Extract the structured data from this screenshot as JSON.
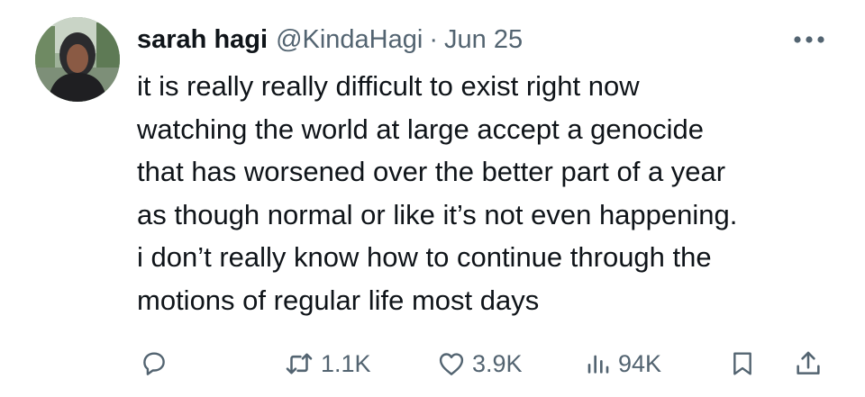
{
  "tweet": {
    "author_name": "sarah hagi",
    "handle": "@KindaHagi",
    "separator": "·",
    "date": "Jun 25",
    "text_lines": [
      "it is really really difficult to exist right now",
      "watching the world at large accept a genocide",
      "that has worsened over the better part of a year",
      "as though normal or like it’s not even happening.",
      "i don’t really know how to continue through the",
      "motions of regular life most days"
    ]
  },
  "actions": {
    "reply": {
      "icon": "reply-icon"
    },
    "retweet": {
      "icon": "retweet-icon",
      "count": "1.1K"
    },
    "like": {
      "icon": "heart-icon",
      "count": "3.9K"
    },
    "views": {
      "icon": "views-icon",
      "count": "94K"
    },
    "bookmark": {
      "icon": "bookmark-icon"
    },
    "share": {
      "icon": "share-icon"
    }
  },
  "more_menu": {
    "icon": "more-dots-icon"
  },
  "colors": {
    "text": "#0f1419",
    "secondary": "#536471"
  }
}
